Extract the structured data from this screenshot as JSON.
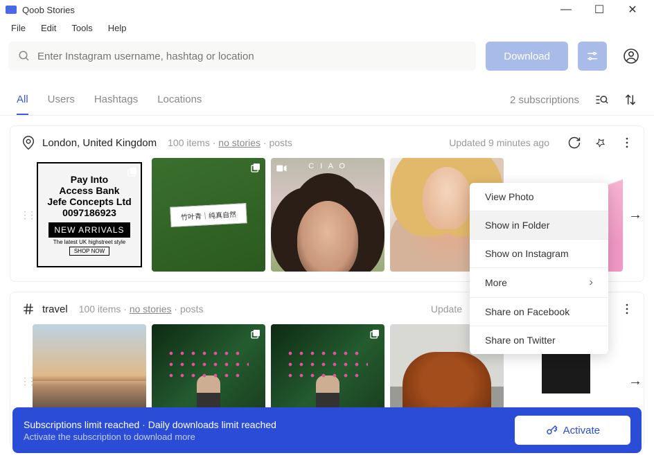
{
  "window": {
    "title": "Qoob Stories"
  },
  "menubar": [
    "File",
    "Edit",
    "Tools",
    "Help"
  ],
  "search": {
    "placeholder": "Enter Instagram username, hashtag or location",
    "download_label": "Download"
  },
  "tabs": {
    "items": [
      "All",
      "Users",
      "Hashtags",
      "Locations"
    ],
    "active": 0,
    "subscriptions": "2 subscriptions"
  },
  "sections": [
    {
      "icon": "location",
      "title": "London, United Kingdom",
      "count": "100 items",
      "stories": "no stories",
      "posts": "posts",
      "updated": "Updated 9 minutes ago",
      "thumb": {
        "line1": "Pay Into",
        "line2": "Access Bank",
        "line3": "Jefe Concepts Ltd",
        "line4": "0097186923",
        "new": "NEW ARRIVALS",
        "sub": "The latest UK highstreet style",
        "shop": "SHOP NOW",
        "tag": "竹叶青｜纯真自然",
        "ciao": "C I A O"
      }
    },
    {
      "icon": "hashtag",
      "title": "travel",
      "count": "100 items",
      "stories": "no stories",
      "posts": "posts",
      "updated": "Update"
    }
  ],
  "context_menu": {
    "items": [
      "View Photo",
      "Show in Folder",
      "Show on Instagram",
      "More",
      "Share on Facebook",
      "Share on Twitter"
    ],
    "hover": 1,
    "submenu_at": 3
  },
  "footer": {
    "line1": "Subscriptions limit reached · Daily downloads limit reached",
    "line2": "Activate the subscription to download more",
    "activate": "Activate"
  }
}
